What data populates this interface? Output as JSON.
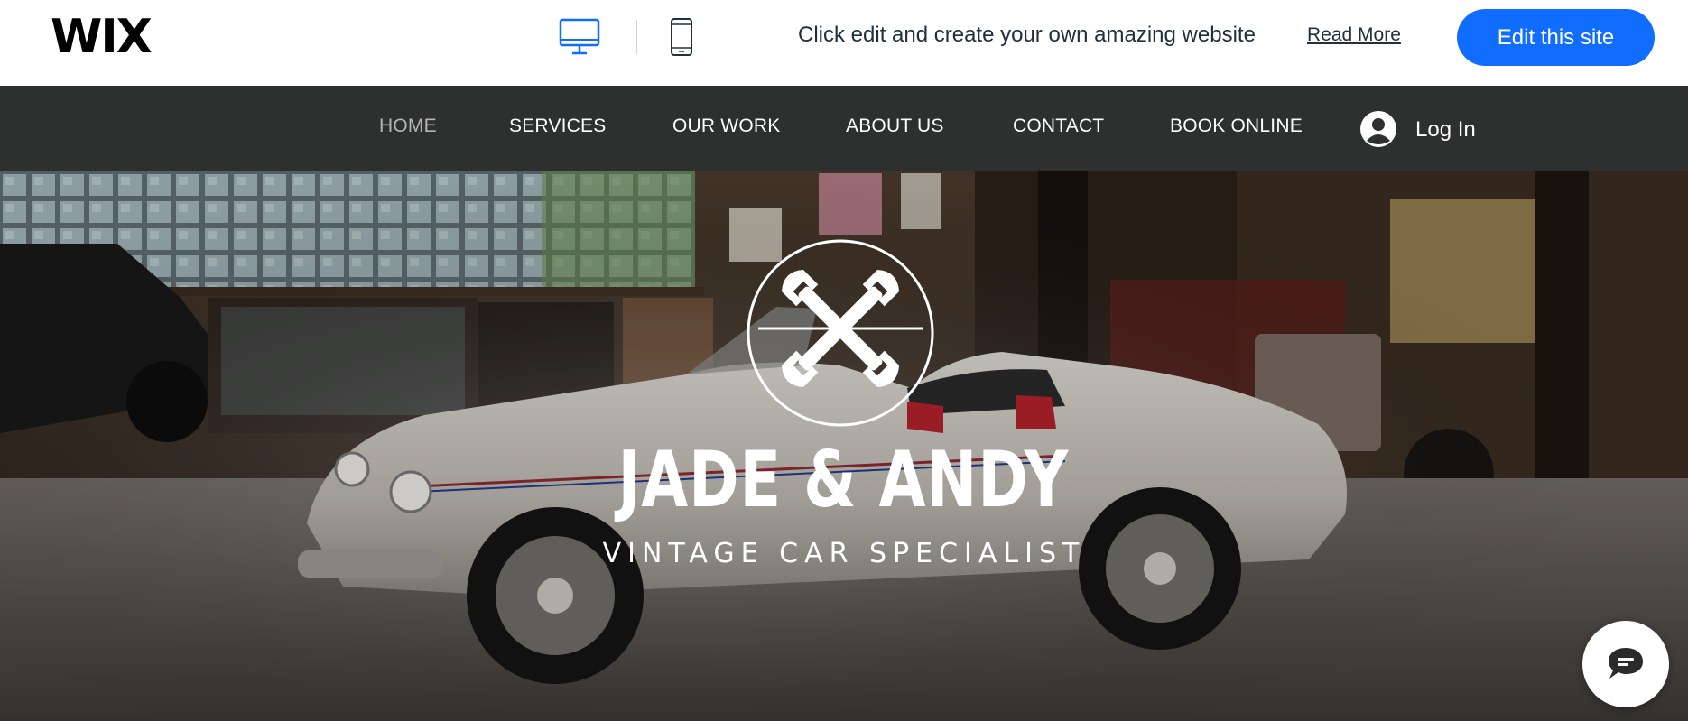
{
  "wix_bar": {
    "logo": "WIX",
    "device_desktop_icon": "desktop-monitor-icon",
    "device_mobile_icon": "mobile-phone-icon",
    "promo_text": "Click edit and create your own amazing website",
    "read_more_label": "Read More",
    "edit_button_label": "Edit this site",
    "colors": {
      "accent": "#116dff",
      "desktop_icon_active": "#116dff"
    }
  },
  "site_nav": {
    "items": [
      {
        "label": "HOME",
        "active": true
      },
      {
        "label": "SERVICES",
        "active": false
      },
      {
        "label": "OUR WORK",
        "active": false
      },
      {
        "label": "ABOUT US",
        "active": false
      },
      {
        "label": "CONTACT",
        "active": false
      },
      {
        "label": "BOOK ONLINE",
        "active": false
      }
    ],
    "login_label": "Log In",
    "login_icon": "user-avatar-icon",
    "colors": {
      "background": "#2e2f2f",
      "text": "#ffffff",
      "active_text": "#b5b5b5"
    }
  },
  "hero": {
    "logo_icon": "crossed-wrenches-icon",
    "title": "JADE & ANDY",
    "subtitle": "VINTAGE CAR SPECIALIST",
    "background": "vintage white roadster in garage workshop"
  },
  "chat": {
    "icon": "chat-bubble-icon"
  }
}
